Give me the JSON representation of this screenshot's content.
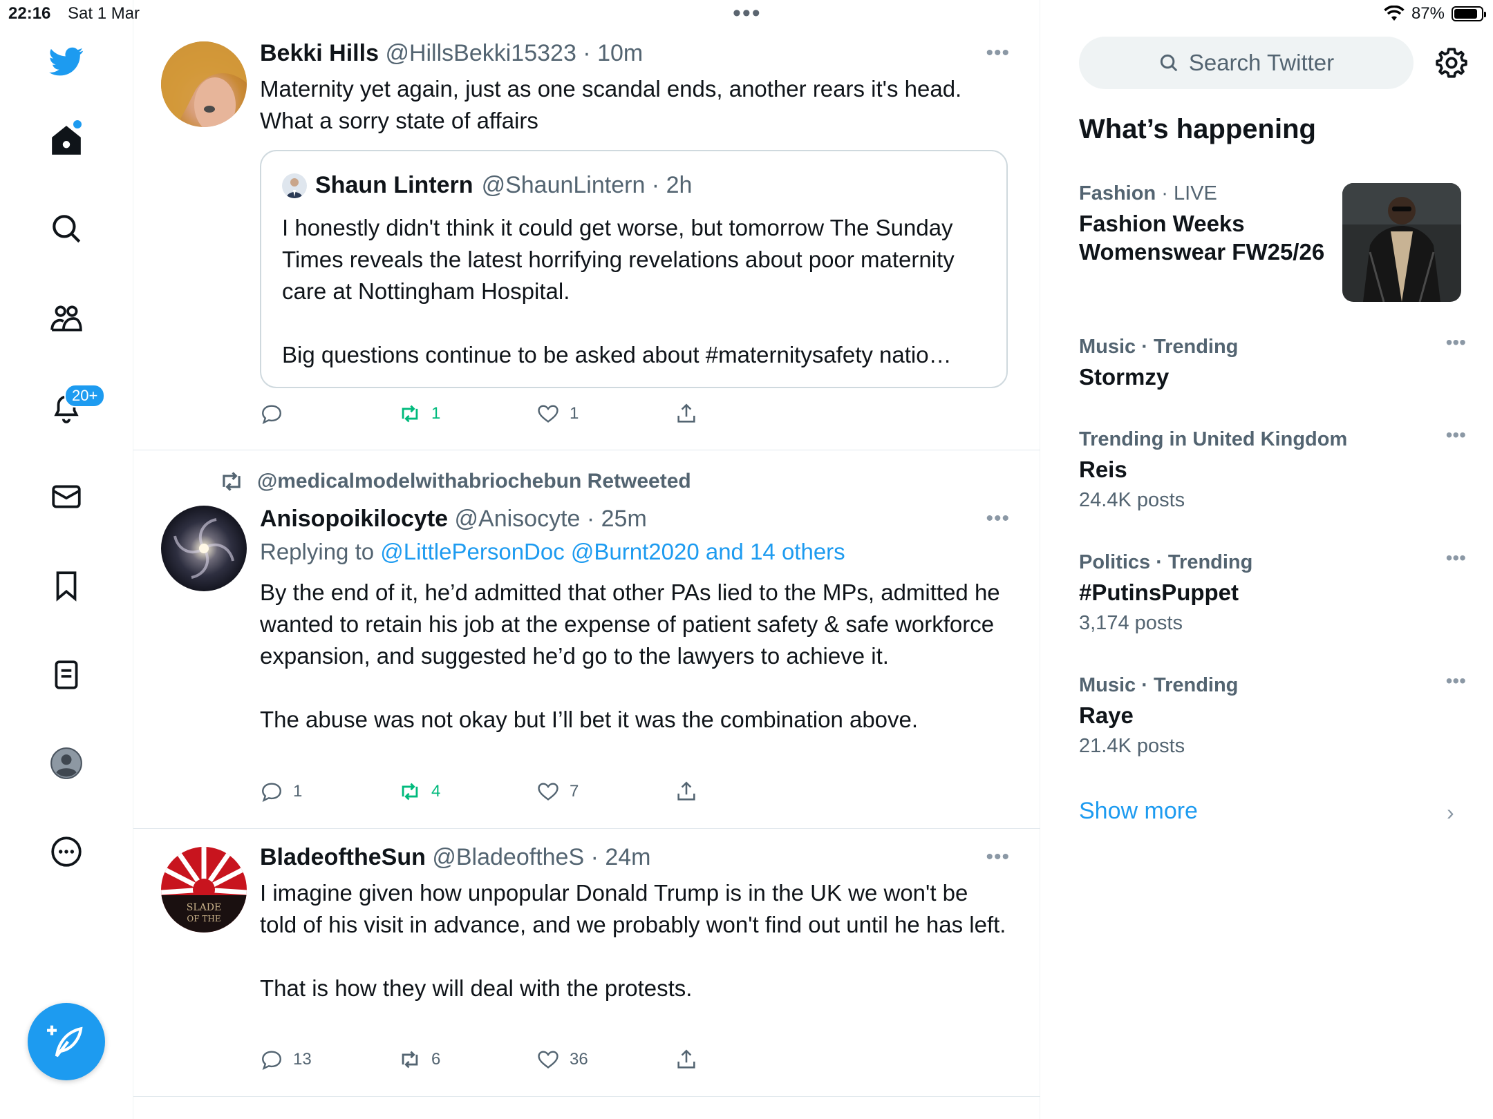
{
  "status": {
    "time": "22:16",
    "date": "Sat 1 Mar",
    "battery": "87%",
    "battery_level": 0.87
  },
  "nav": {
    "notifications_badge": "20+"
  },
  "colors": {
    "accent": "#1d9bf0",
    "retweet_green": "#00ba7c",
    "muted": "#536471"
  },
  "tweets": [
    {
      "name": "Bekki Hills",
      "handle": "@HillsBekki15323 · 10m",
      "text": "Maternity yet again, just as one scandal ends, another rears it's head.\nWhat a sorry state of affairs",
      "quote": {
        "name": "Shaun Lintern",
        "handle": "@ShaunLintern · 2h",
        "text": "I honestly didn't think it could get worse, but tomorrow The Sunday Times reveals the latest horrifying revelations about poor maternity care at Nottingham Hospital.\n\nBig questions continue to be asked about #maternitysafety natio…"
      },
      "replies": "",
      "retweets": "1",
      "likes": "1"
    },
    {
      "retweeted_by": "@medicalmodelwithabriochebun Retweeted",
      "name": "Anisopoikilocyte",
      "handle": "@Anisocyte · 25m",
      "reply_prefix": "Replying to",
      "reply_to": "@LittlePersonDoc @Burnt2020 and 14 others",
      "text": "By the end of it, he’d admitted that other PAs lied to the MPs, admitted he wanted to retain his job at the expense of patient safety & safe workforce expansion, and suggested he’d go to the lawyers to achieve it.\n\nThe abuse was not okay but I’ll bet it was the combination above.",
      "replies": "1",
      "retweets": "4",
      "likes": "7"
    },
    {
      "name": "BladeoftheSun",
      "handle": "@BladeoftheS · 24m",
      "text": "I imagine given how unpopular Donald Trump is in the UK we won't be told of his visit in advance, and we probably won't find out until he has left.\n\nThat is how they will deal with the protests.",
      "replies": "13",
      "retweets": "6",
      "likes": "36"
    }
  ],
  "sidebar": {
    "search_placeholder": "Search Twitter",
    "title": "What’s happening",
    "trends": [
      {
        "category": "Fashion",
        "category_suffix": " · LIVE",
        "name": "Fashion Weeks Womenswear FW25/26",
        "posts": ""
      },
      {
        "category": "Music · Trending",
        "category_suffix": "",
        "name": "Stormzy",
        "posts": ""
      },
      {
        "category": "Trending in United Kingdom",
        "category_suffix": "",
        "name": "Reis",
        "posts": "24.4K posts"
      },
      {
        "category": "Politics · Trending",
        "category_suffix": "",
        "name": "#PutinsPuppet",
        "posts": "3,174 posts"
      },
      {
        "category": "Music · Trending",
        "category_suffix": "",
        "name": "Raye",
        "posts": "21.4K posts"
      }
    ],
    "show_more": "Show more"
  }
}
